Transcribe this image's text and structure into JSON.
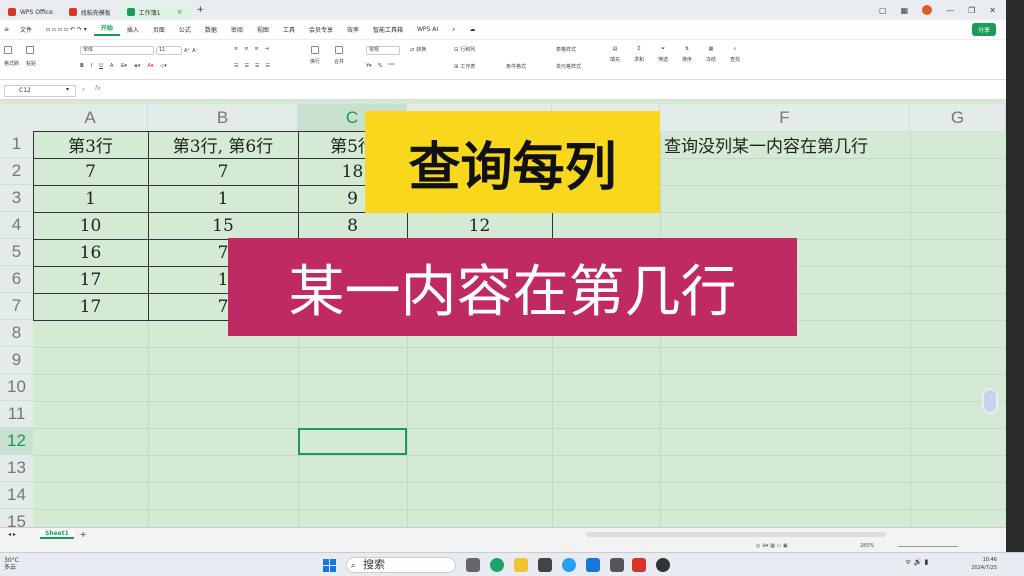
{
  "tabs": [
    {
      "label": "WPS Office",
      "color": "#d9342b"
    },
    {
      "label": "找稻壳模板",
      "color": "#d9342b"
    },
    {
      "label": "工作簿1",
      "color": "#1a9b57"
    }
  ],
  "menu": [
    "文件",
    "开始",
    "插入",
    "页面",
    "公式",
    "数据",
    "审阅",
    "视图",
    "工具",
    "会员专享",
    "效率",
    "智能工具箱",
    "WPS AI"
  ],
  "active_menu": "开始",
  "share_label": "分享",
  "ribbon": {
    "font_name": "宋体",
    "font_size": "11",
    "number_format": "常规",
    "labels": [
      "格式刷",
      "粘贴",
      "换行",
      "合并",
      "转换",
      "行和列",
      "工作表",
      "条件格式",
      "表格样式",
      "单元格样式",
      "求和",
      "筛选",
      "排序",
      "填充",
      "查找",
      "冻结"
    ]
  },
  "name_box": "C12",
  "fx_label": "fx",
  "columns": [
    "A",
    "B",
    "C",
    "D",
    "E",
    "F",
    "G"
  ],
  "selected_column": "C",
  "rows": [
    "1",
    "2",
    "3",
    "4",
    "5",
    "6",
    "7",
    "8",
    "9",
    "10",
    "11",
    "12",
    "13",
    "14",
    "15"
  ],
  "selected_row": "12",
  "cells": {
    "A1": "第3行",
    "B1": "第3行, 第6行",
    "C1": "第5行",
    "F1": "查询没列某一内容在第几行",
    "A2": "7",
    "B2": "7",
    "C2": "18",
    "A3": "1",
    "B3": "1",
    "C3": "9",
    "A4": "10",
    "B4": "15",
    "C4": "8",
    "D4": "12",
    "A5": "16",
    "B5": "7",
    "A6": "17",
    "B6": "1",
    "A7": "17",
    "B7": "7"
  },
  "overlay_title": "查询每列",
  "overlay_subtitle": "某一内容在第几行",
  "overlay_colors": {
    "title_bg": "#f8d71c",
    "subtitle_bg": "#c02a63"
  },
  "sheet_tab": "Sheet1",
  "zoom": "280%",
  "taskbar": {
    "weather_temp": "30°C",
    "weather_desc": "多云",
    "search_placeholder": "搜索",
    "time": "10:46",
    "date": "2024/7/25"
  }
}
